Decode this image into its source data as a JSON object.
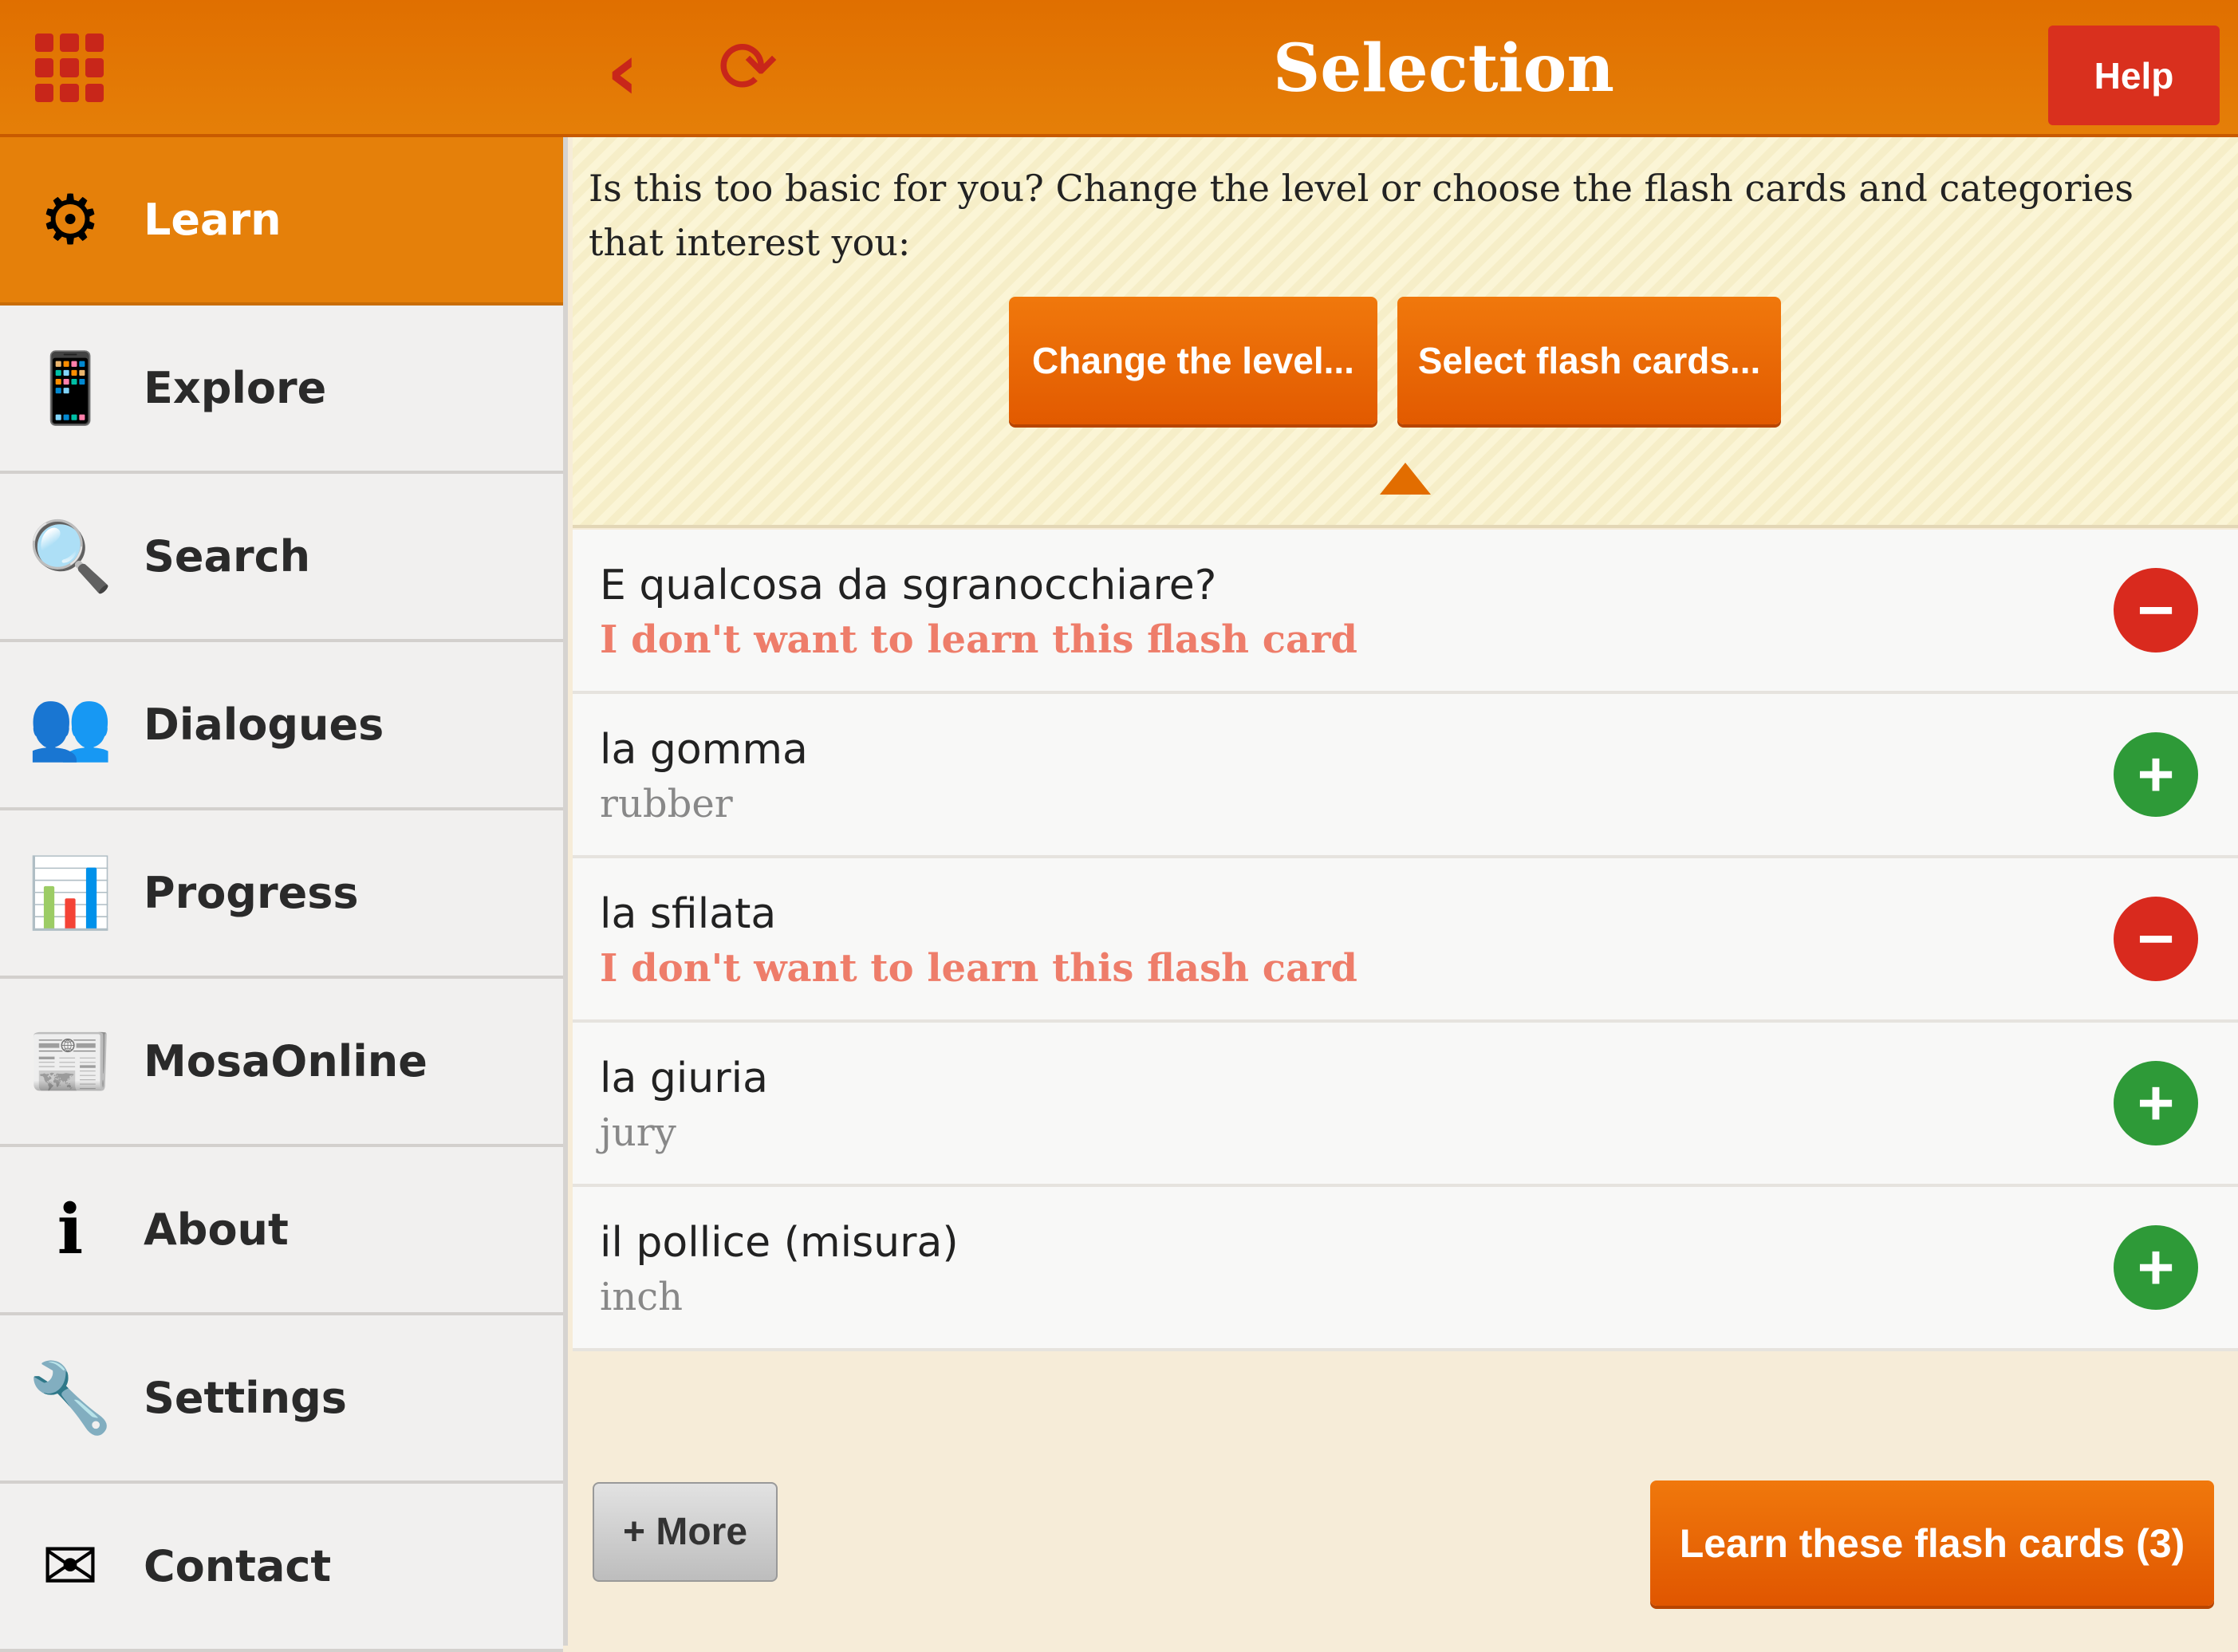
{
  "header": {
    "title": "Selection",
    "help_label": "Help",
    "icons": [
      "grid-menu-icon",
      "back-chevron-icon",
      "refresh-icon"
    ],
    "color": "#e57f08"
  },
  "sidebar": {
    "items": [
      {
        "label": "Learn",
        "icon": "gear-plus-icon",
        "glyph": "⚙",
        "active": true
      },
      {
        "label": "Explore",
        "icon": "tablet-magnifier-icon",
        "glyph": "📱"
      },
      {
        "label": "Search",
        "icon": "magnifier-icon",
        "glyph": "🔍"
      },
      {
        "label": "Dialogues",
        "icon": "people-speech-icon",
        "glyph": "👥"
      },
      {
        "label": "Progress",
        "icon": "bar-chart-icon",
        "glyph": "📊"
      },
      {
        "label": "MosaOnline",
        "icon": "newspaper-icon",
        "glyph": "📰"
      },
      {
        "label": "About",
        "icon": "info-icon",
        "glyph": "ℹ"
      },
      {
        "label": "Settings",
        "icon": "tools-icon",
        "glyph": "🔧"
      },
      {
        "label": "Contact",
        "icon": "paper-plane-icon",
        "glyph": "✉"
      }
    ]
  },
  "banner": {
    "text": "Is this too basic for you? Change the level or choose the flash cards and categories that interest you:",
    "change_level": "Change the level...",
    "select_cards": "Select flash cards..."
  },
  "cards": [
    {
      "italian": "E qualcosa da sgranocchiare?",
      "english": "I don't want to learn this flash card",
      "included": false
    },
    {
      "italian": "la gomma",
      "english": "rubber",
      "included": true
    },
    {
      "italian": "la sfilata",
      "english": "I don't want to learn this flash card",
      "included": false
    },
    {
      "italian": "la giuria",
      "english": "jury",
      "included": true
    },
    {
      "italian": "il pollice (misura)",
      "english": "inch",
      "included": true
    }
  ],
  "footer": {
    "more_label": "+ More",
    "learn_label": "Learn these flash cards (3)"
  }
}
